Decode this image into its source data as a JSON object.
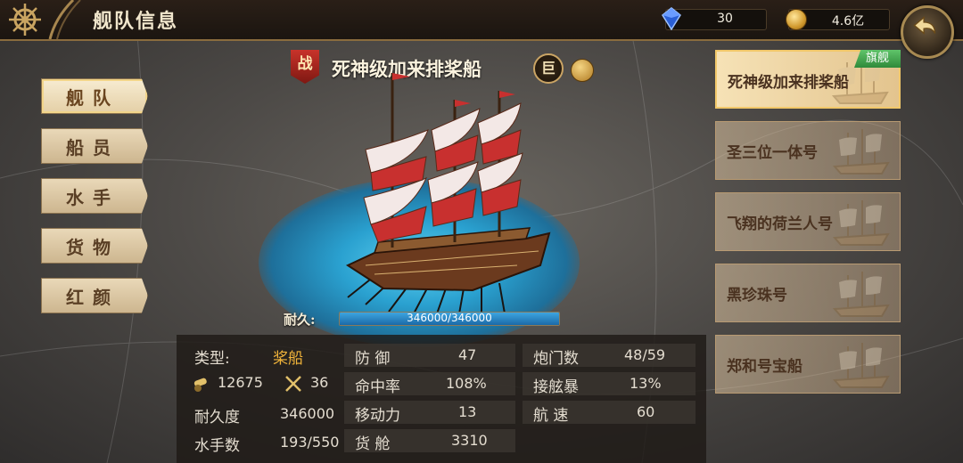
{
  "header": {
    "title": "舰队信息",
    "gems": "30",
    "coins": "4.6亿"
  },
  "nav": [
    "舰队",
    "船员",
    "水手",
    "货物",
    "红颜"
  ],
  "ship": {
    "battle_tag": "战",
    "name": "死神级加来排桨船",
    "size_tag": "巨",
    "durability_label": "耐久:",
    "durability_text": "346000/346000",
    "durability_fraction": 1.0
  },
  "stats": {
    "type_label": "类型:",
    "type_value": "桨船",
    "cannons": "12675",
    "soldiers": "36",
    "durability_label": "耐久度",
    "durability_value": "346000",
    "sailors_label": "水手数",
    "sailors_value": "193/550",
    "defense_label": "防  御",
    "defense_value": "47",
    "accuracy_label": "命中率",
    "accuracy_value": "108%",
    "mobility_label": "移动力",
    "mobility_value": "13",
    "cargo_label": "货  舱",
    "cargo_value": "3310",
    "ports_label": "炮门数",
    "ports_value": "48/59",
    "boarding_label": "接舷暴",
    "boarding_value": "13%",
    "speed_label": "航  速",
    "speed_value": "60"
  },
  "ship_list": [
    {
      "name": "死神级加来排桨船",
      "tag": "旗舰",
      "active": true
    },
    {
      "name": "圣三位一体号"
    },
    {
      "name": "飞翔的荷兰人号"
    },
    {
      "name": "黑珍珠号"
    },
    {
      "name": "郑和号宝船"
    }
  ],
  "colors": {
    "accent_gold": "#f3b53a",
    "sail_red": "#c8302f",
    "water": "#2aa1d0"
  }
}
